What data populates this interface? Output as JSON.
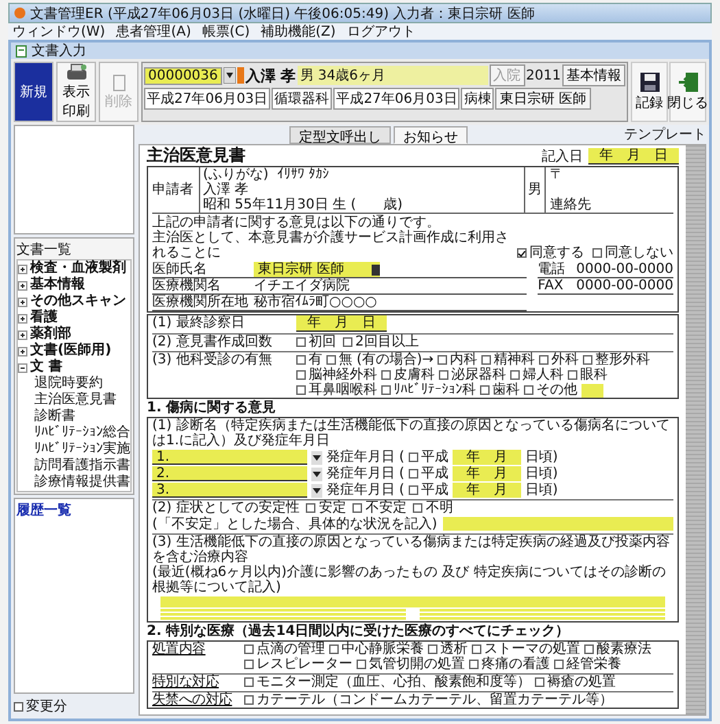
{
  "window": {
    "title": "文書管理ER (平成27年06月03日 (水曜日) 午後06:05:49) 入力者：東日宗研 医師"
  },
  "menu": [
    "ウィンドウ(W)",
    "患者管理(A)",
    "帳票(C)",
    "補助機能(Z)",
    "ログアウト"
  ],
  "child_window": {
    "title": "文書入力"
  },
  "toolbar": [
    {
      "label": "新規",
      "kind": "new",
      "selected": true,
      "disabled": false
    },
    {
      "label": "表示印刷",
      "kind": "print",
      "selected": false,
      "disabled": false
    },
    {
      "label": "削除",
      "kind": "delete",
      "selected": false,
      "disabled": true
    }
  ],
  "patient": {
    "id": "00000036",
    "name": "入澤 孝",
    "sex_age": "男 34歳6ヶ月",
    "status": "入院",
    "year": "2011",
    "info_button": "基本情報",
    "date": "平成27年06月03日",
    "department": "循環器科",
    "entry_date": "平成27年06月03日",
    "ward": "病棟",
    "doctor": "東日宗研 医師"
  },
  "tabs": [
    {
      "label": "定型文呼出し",
      "selected": false
    },
    {
      "label": "お知らせ",
      "selected": true
    }
  ],
  "right_buttons": [
    {
      "label": "記録",
      "kind": "save"
    },
    {
      "label": "閉じる",
      "kind": "close"
    }
  ],
  "template_label": "テンプレート",
  "document_list": {
    "title": "文書一覧",
    "items": [
      {
        "label": "検査・血液製剤",
        "expanded": false
      },
      {
        "label": "基本情報",
        "expanded": false
      },
      {
        "label": "その他スキャン",
        "expanded": false
      },
      {
        "label": "看護",
        "expanded": false
      },
      {
        "label": "薬剤部",
        "expanded": false
      },
      {
        "label": "文書(医師用)",
        "expanded": false
      },
      {
        "label": "文 書",
        "expanded": true,
        "children": [
          "退院時要約",
          "主治医意見書",
          "診断書",
          "ﾘﾊﾋﾞﾘﾃｰｼｮﾝ総合",
          "ﾘﾊﾋﾞﾘﾃｰｼｮﾝ実施",
          "訪問看護指示書",
          "診療情報提供書"
        ]
      }
    ]
  },
  "history": {
    "title": "履歴一覧"
  },
  "changed_only": {
    "label": "変更分",
    "checked": false
  },
  "form": {
    "title": "主治医意見書",
    "record_date": {
      "label": "記入日",
      "value": "年　月　日"
    },
    "applicant": {
      "label": "申請者",
      "furigana_label": "(ふりがな)",
      "furigana": "ｲﾘｻﾜ ﾀｶｼ",
      "name": "入澤 孝",
      "birth": "昭和 55年11月30日 生 (　　歳)",
      "sex": "男",
      "postal": "〒",
      "contact": "連絡先"
    },
    "consent": {
      "lines": [
        "上記の申請者に関する意見は以下の通りです。",
        "主治医として、本意見書が介護サービス計画作成に利用されることに"
      ],
      "options": [
        {
          "label": "同意する",
          "checked": true
        },
        {
          "label": "同意しない",
          "checked": false
        }
      ]
    },
    "doctor_fields": [
      {
        "label": "医師氏名",
        "value": "東日宗研 医師",
        "kind": "select"
      },
      {
        "label": "医療機関名",
        "value": "イチエイダ病院",
        "kind": "text"
      },
      {
        "label": "医療機関所在地",
        "value": "秘市宿ｲﾑﾗ町○○○○",
        "kind": "text"
      }
    ],
    "contacts": [
      {
        "label": "電話",
        "value": "0000-00-0000"
      },
      {
        "label": "FAX",
        "value": "0000-00-0000"
      }
    ],
    "last_exam": {
      "label": "(1) 最終診察日",
      "value": "年　月　日"
    },
    "count": {
      "label": "(2) 意見書作成回数",
      "options": [
        {
          "label": "初回",
          "checked": false
        },
        {
          "label": "2回目以上",
          "checked": false
        }
      ]
    },
    "other_dept": {
      "label": "(3) 他科受診の有無",
      "options": [
        {
          "label": "有",
          "checked": false
        },
        {
          "label": "無",
          "checked": false
        }
      ],
      "note": "(有の場合)→",
      "departments": [
        {
          "label": "内科",
          "checked": false
        },
        {
          "label": "精神科",
          "checked": false
        },
        {
          "label": "外科",
          "checked": false
        },
        {
          "label": "整形外科",
          "checked": false
        },
        {
          "label": "脳神経外科",
          "checked": false
        },
        {
          "label": "皮膚科",
          "checked": false
        },
        {
          "label": "泌尿器科",
          "checked": false
        },
        {
          "label": "婦人科",
          "checked": false
        },
        {
          "label": "眼科",
          "checked": false
        },
        {
          "label": "耳鼻咽喉科",
          "checked": false
        },
        {
          "label": "ﾘﾊﾋﾞﾘﾃｰｼｮﾝ科",
          "checked": false
        },
        {
          "label": "歯科",
          "checked": false
        },
        {
          "label": "その他",
          "checked": false
        }
      ]
    },
    "section1": {
      "title": "1. 傷病に関する意見",
      "diagnosis_label": "(1) 診断名（特定疾病または生活機能低下の直接の原因となっている傷病名については1.に記入）及び発症年月日",
      "diagnoses": [
        {
          "number": "1.",
          "onset_label": "発症年月日",
          "open": "(",
          "era": "平成",
          "checked": false,
          "date": "年　月",
          "suffix": "日頃)"
        },
        {
          "number": "2.",
          "onset_label": "発症年月日",
          "open": "(",
          "era": "平成",
          "checked": false,
          "date": "年　月",
          "suffix": "日頃)"
        },
        {
          "number": "3.",
          "onset_label": "発症年月日",
          "open": "(",
          "era": "平成",
          "checked": false,
          "date": "年　月",
          "suffix": "日頃)"
        }
      ],
      "stability": {
        "label": "(2) 症状としての安定性",
        "options": [
          {
            "label": "安定",
            "checked": false
          },
          {
            "label": "不安定",
            "checked": false
          },
          {
            "label": "不明",
            "checked": false
          }
        ]
      },
      "unstable_note": "(「不安定」とした場合、具体的な状況を記入)",
      "course_label": "(3) 生活機能低下の直接の原因となっている傷病または特定疾病の経過及び投薬内容を含む治療内容",
      "course_note": "(最近(概ね6ヶ月以内)介護に影響のあったもの 及び 特定疾病についてはその診断の根拠等について記入)"
    },
    "section2": {
      "title": "2. 特別な医療（過去14日間以内に受けた医療のすべてにチェック）",
      "groups": [
        {
          "label": "処置内容",
          "options": [
            {
              "label": "点滴の管理",
              "checked": false
            },
            {
              "label": "中心静脈栄養",
              "checked": false
            },
            {
              "label": "透析",
              "checked": false
            },
            {
              "label": "ストーマの処置",
              "checked": false
            },
            {
              "label": "酸素療法",
              "checked": false
            },
            {
              "label": "レスピレーター",
              "checked": false
            },
            {
              "label": "気管切開の処置",
              "checked": false
            },
            {
              "label": "疼痛の看護",
              "checked": false
            },
            {
              "label": "経管栄養",
              "checked": false
            }
          ]
        },
        {
          "label": "特別な対応",
          "options": [
            {
              "label": "モニター測定（血圧、心拍、酸素飽和度等）",
              "checked": false
            },
            {
              "label": "褥瘡の処置",
              "checked": false
            }
          ]
        },
        {
          "label": "失禁への対応",
          "options": [
            {
              "label": "カテーテル（コンドームカテーテル、留置カテーテル等）",
              "checked": false
            }
          ]
        }
      ]
    }
  }
}
